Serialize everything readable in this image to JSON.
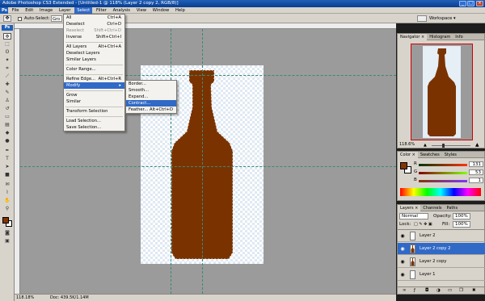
{
  "app": {
    "title": "Adobe Photoshop CS3 Extended - [Untitled-1 @ 118% (Layer 2 copy 2, RGB/8)]",
    "logo": "Ps"
  },
  "window_controls": [
    "_",
    "□",
    "×"
  ],
  "menubar": [
    "File",
    "Edit",
    "Image",
    "Layer",
    "Select",
    "Filter",
    "Analysis",
    "View",
    "Window",
    "Help"
  ],
  "options": {
    "auto_select": "Auto-Select:",
    "group": "Gro",
    "workspace": "Workspace ▾"
  },
  "select_menu": [
    {
      "label": "All",
      "shortcut": "Ctrl+A"
    },
    {
      "label": "Deselect",
      "shortcut": "Ctrl+D"
    },
    {
      "label": "Reselect",
      "shortcut": "Shift+Ctrl+D",
      "disabled": true
    },
    {
      "label": "Inverse",
      "shortcut": "Shift+Ctrl+I"
    },
    {
      "sep": true
    },
    {
      "label": "All Layers",
      "shortcut": "Alt+Ctrl+A"
    },
    {
      "label": "Deselect Layers",
      "shortcut": ""
    },
    {
      "label": "Similar Layers",
      "shortcut": ""
    },
    {
      "sep": true
    },
    {
      "label": "Color Range...",
      "shortcut": ""
    },
    {
      "sep": true
    },
    {
      "label": "Refine Edge...",
      "shortcut": "Alt+Ctrl+R"
    },
    {
      "label": "Modify",
      "shortcut": "▸",
      "highlight": true
    },
    {
      "sep": true
    },
    {
      "label": "Grow",
      "shortcut": ""
    },
    {
      "label": "Similar",
      "shortcut": ""
    },
    {
      "sep": true
    },
    {
      "label": "Transform Selection",
      "shortcut": ""
    },
    {
      "sep": true
    },
    {
      "label": "Load Selection...",
      "shortcut": ""
    },
    {
      "label": "Save Selection...",
      "shortcut": ""
    }
  ],
  "modify_menu": [
    {
      "label": "Border...",
      "shortcut": ""
    },
    {
      "label": "Smooth...",
      "shortcut": ""
    },
    {
      "label": "Expand...",
      "shortcut": ""
    },
    {
      "label": "Contract...",
      "shortcut": "",
      "highlight": true
    },
    {
      "label": "Feather...",
      "shortcut": "Alt+Ctrl+D"
    }
  ],
  "navigator": {
    "tabs": [
      "Navigator ×",
      "Histogram",
      "Info"
    ],
    "zoom": "118.6%"
  },
  "color": {
    "tabs": [
      "Color ×",
      "Swatches",
      "Styles"
    ],
    "r_label": "R",
    "g_label": "G",
    "b_label": "B",
    "r": "131",
    "g": "53",
    "b": "1"
  },
  "layers": {
    "tabs": [
      "Layers ×",
      "Channels",
      "Paths"
    ],
    "blend": "Normal",
    "opacity_label": "Opacity:",
    "opacity": "100%",
    "lock_label": "Lock:",
    "fill_label": "Fill:",
    "fill": "100%",
    "items": [
      {
        "name": "Layer 2",
        "selected": false,
        "bottle": false
      },
      {
        "name": "Layer 2 copy 2",
        "selected": true,
        "bottle": true
      },
      {
        "name": "Layer 2 copy",
        "selected": false,
        "bottle": true
      },
      {
        "name": "Layer 1",
        "selected": false,
        "bottle": false
      }
    ],
    "footer_icons": [
      "link-icon",
      "fx-icon",
      "mask-icon",
      "adjustment-icon",
      "folder-icon",
      "new-layer-icon",
      "trash-icon"
    ]
  },
  "status": {
    "zoom": "118.18%",
    "doc": "Doc: 439.5K/1.14M"
  },
  "colors": {
    "bottle": "#7a3300",
    "foreground": "#833501",
    "background": "#ffffff",
    "accent": "#3169c6"
  }
}
